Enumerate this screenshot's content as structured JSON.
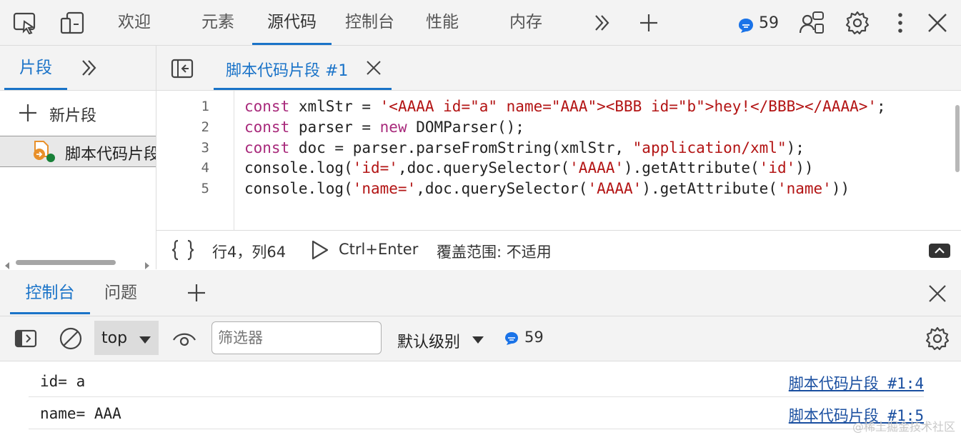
{
  "top_tabs": [
    "欢迎",
    "元素",
    "源代码",
    "控制台",
    "性能",
    "内存"
  ],
  "issues_count": "59",
  "sidebar": {
    "tab_label": "片段",
    "new_snippet_label": "新片段",
    "snippet_item": "脚本代码片段"
  },
  "editor": {
    "tab_label": "脚本代码片段 #1",
    "line_numbers": [
      "1",
      "2",
      "3",
      "4",
      "5"
    ],
    "status": {
      "position": "行4，列64",
      "run_shortcut": "Ctrl+Enter",
      "coverage": "覆盖范围: 不适用"
    }
  },
  "drawer": {
    "tabs": [
      "控制台",
      "问题"
    ]
  },
  "console_toolbar": {
    "context": "top",
    "filter_placeholder": "筛选器",
    "level": "默认级别",
    "message_count": "59"
  },
  "console_messages": [
    {
      "text": "id= a",
      "source": "脚本代码片段 #1:4"
    },
    {
      "text": "name= AAA",
      "source": "脚本代码片段 #1:5"
    }
  ],
  "watermark": "@稀土掘金技术社区",
  "colors": {
    "accent": "#1a73c8",
    "keyword": "#a8297b",
    "string": "#b31414",
    "badge": "#1a73e8"
  }
}
